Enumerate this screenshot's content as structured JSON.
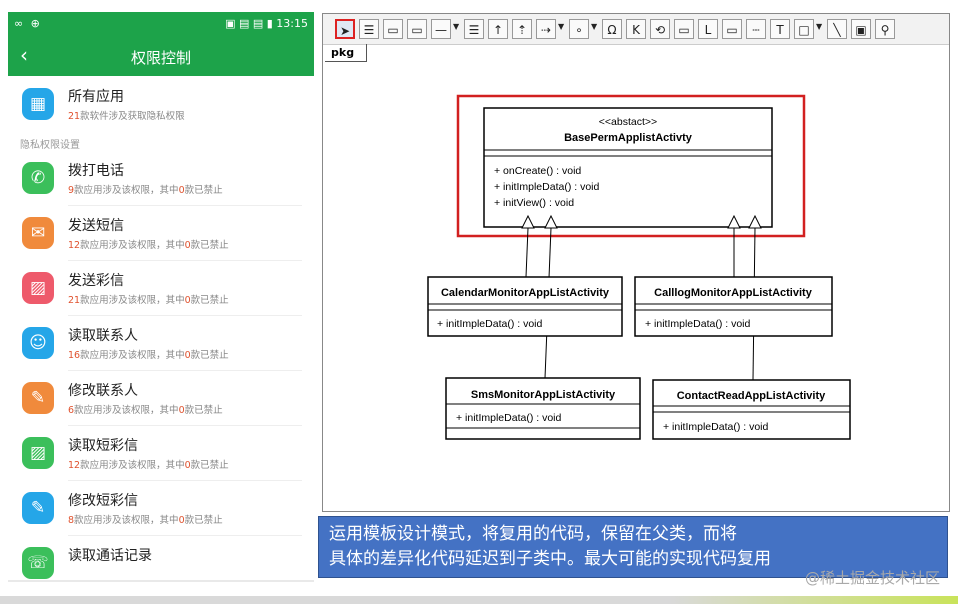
{
  "phone": {
    "status": {
      "left": "∞ ⊕",
      "right": "▣ ▤ ▤ ▮ 13:15"
    },
    "title": "权限控制",
    "all_apps": {
      "title": "所有应用",
      "count": "21",
      "suffix": "款软件涉及获取隐私权限",
      "icon": "grid-icon"
    },
    "section_header": "隐私权限设置",
    "items": [
      {
        "title": "拨打电话",
        "count": "9",
        "mid": "款应用涉及该权限，其中",
        "banned": "0",
        "end": "款已禁止",
        "color": "#3bbf5b",
        "icon": "phone-icon",
        "glyph": "✆"
      },
      {
        "title": "发送短信",
        "count": "12",
        "mid": "款应用涉及该权限，其中",
        "banned": "0",
        "end": "款已禁止",
        "color": "#f08a3c",
        "icon": "mail-icon",
        "glyph": "✉"
      },
      {
        "title": "发送彩信",
        "count": "21",
        "mid": "款应用涉及该权限，其中",
        "banned": "0",
        "end": "款已禁止",
        "color": "#ee5a6b",
        "icon": "image-icon",
        "glyph": "▨"
      },
      {
        "title": "读取联系人",
        "count": "16",
        "mid": "款应用涉及该权限，其中",
        "banned": "0",
        "end": "款已禁止",
        "color": "#25a6e8",
        "icon": "person-icon",
        "glyph": "☺"
      },
      {
        "title": "修改联系人",
        "count": "6",
        "mid": "款应用涉及该权限，其中",
        "banned": "0",
        "end": "款已禁止",
        "color": "#f08a3c",
        "icon": "edit-person-icon",
        "glyph": "✎"
      },
      {
        "title": "读取短彩信",
        "count": "12",
        "mid": "款应用涉及该权限，其中",
        "banned": "0",
        "end": "款已禁止",
        "color": "#3bbf5b",
        "icon": "message-image-icon",
        "glyph": "▨"
      },
      {
        "title": "修改短彩信",
        "count": "8",
        "mid": "款应用涉及该权限，其中",
        "banned": "0",
        "end": "款已禁止",
        "color": "#25a6e8",
        "icon": "edit-message-icon",
        "glyph": "✎"
      },
      {
        "title": "读取通话记录",
        "count": "",
        "mid": "",
        "banned": "",
        "end": "",
        "color": "#3bbf5b",
        "icon": "call-log-icon",
        "glyph": "☏"
      }
    ]
  },
  "editor": {
    "toolbar_icons": [
      "select-arrow-icon",
      "class-icon",
      "package-icon",
      "package-detail-icon",
      "line-icon",
      "interface-icon",
      "generalization-icon",
      "realization-icon",
      "dependency-icon",
      "circle-icon",
      "actor-icon",
      "component-icon",
      "state-icon",
      "note-icon",
      "frame-icon",
      "rectangle-icon",
      "dashed-line-icon",
      "text-icon",
      "box-icon",
      "diagonal-line-icon",
      "image-icon",
      "other-tool-icon"
    ],
    "toolbar_glyphs": [
      "➤",
      "☰",
      "▭",
      "▭",
      "—",
      "☰",
      "↑",
      "⇡",
      "⇢",
      "∘",
      "Ω",
      "K",
      "⟲",
      "▭",
      "L",
      "▭",
      "┄",
      "T",
      "□",
      "╲",
      "▣",
      "⚲"
    ],
    "package_tab": "pkg",
    "abstract_class": {
      "stereotype": "<<abstact>>",
      "name": "BasePermApplistActivty",
      "ops": [
        "+ onCreate() : void",
        "+ initImpleData() : void",
        "+ initView() : void"
      ]
    },
    "subclasses": [
      {
        "name": "CalendarMonitorAppListActivity",
        "op": "+ initImpleData() : void"
      },
      {
        "name": "CalllogMonitorAppListActivity",
        "op": "+ initImpleData() : void"
      },
      {
        "name": "SmsMonitorAppListActivity",
        "op": "+ initImpleData() : void"
      },
      {
        "name": "ContactReadAppListActivity",
        "op": "+ initImpleData() : void"
      }
    ]
  },
  "caption": {
    "line1": "运用模板设计模式，将复用的代码，保留在父类，而将",
    "line2": "具体的差异化代码延迟到子类中。最大可能的实现代码复用"
  },
  "watermark": "@稀土掘金技术社区",
  "colors": {
    "phone_green": "#1da34a",
    "highlight_red": "#d22020",
    "caption_blue": "#4472c4"
  }
}
